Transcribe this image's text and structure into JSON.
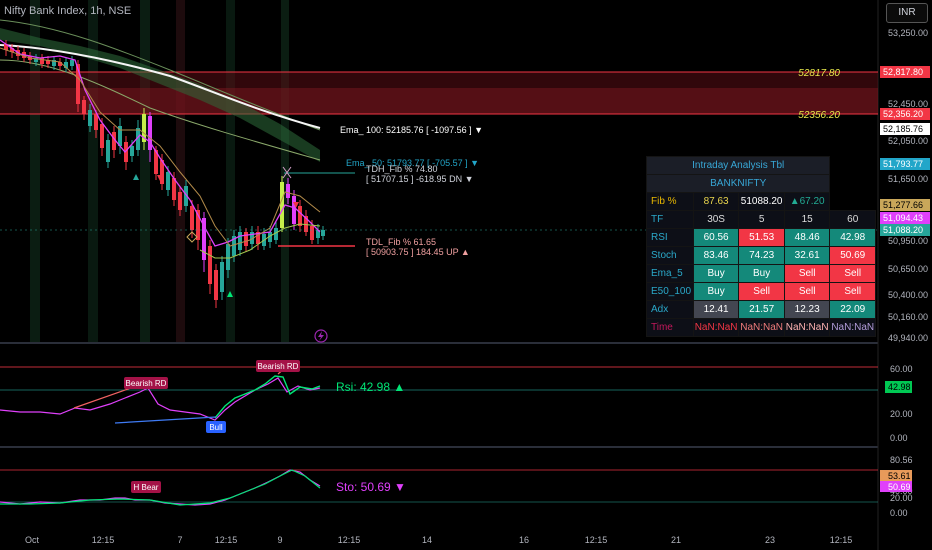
{
  "header": {
    "title": "Nifty Bank Index, 1h, NSE",
    "currency_button": "INR"
  },
  "price_axis": [
    "53,250.00",
    "52,450.00",
    "52,050.00",
    "51,650.00",
    "50,950.00",
    "50,650.00",
    "50,400.00",
    "50,160.00",
    "49,940.00"
  ],
  "price_tags": [
    {
      "text": "52,817.80",
      "bg": "#f23645",
      "fg": "#ffffff"
    },
    {
      "text": "52,356.20",
      "bg": "#f23645",
      "fg": "#ffffff"
    },
    {
      "text": "52,185.76",
      "bg": "#ffffff",
      "fg": "#000000"
    },
    {
      "text": "51,793.77",
      "bg": "#22a6c9",
      "fg": "#ffffff"
    },
    {
      "text": "51,277.66",
      "bg": "#c9a75a",
      "fg": "#000000"
    },
    {
      "text": "51,094.43",
      "bg": "#e040fb",
      "fg": "#ffffff"
    },
    {
      "text": "51,088.20",
      "bg": "#26a69a",
      "fg": "#ffffff"
    }
  ],
  "fib_lines": [
    {
      "label": "52817.80",
      "color": "#e8e84a"
    },
    {
      "label": "52356.20",
      "color": "#e8e84a"
    }
  ],
  "chart_labels": {
    "ema100": "Ema_ 100: 52185.76 [ -1097.56 ] ▼",
    "ema50": "Ema_ 50: 51793.77 [ -705.57 ] ▼",
    "tdh": "TDH_Fib % 74.80",
    "tdh2": "[ 51707.15 ] -618.95 DN ▼",
    "tdl": "TDL_Fib % 61.65",
    "tdl2": "[ 50903.75 ] 184.45 UP ▲"
  },
  "table": {
    "title": "Intraday Analysis Tbl",
    "symbol": "BANKNIFTY",
    "fib": {
      "label": "Fib %",
      "value": "87.63",
      "price": "51088.20",
      "change": "▲67.20"
    },
    "tf": {
      "label": "TF",
      "cols": [
        "30S",
        "5",
        "15",
        "60"
      ]
    },
    "rows": [
      {
        "label": "RSI",
        "values": [
          "60.56",
          "51.53",
          "48.46",
          "42.98"
        ],
        "colors": [
          "g",
          "r",
          "g",
          "g"
        ]
      },
      {
        "label": "Stoch",
        "values": [
          "83.46",
          "74.23",
          "32.61",
          "50.69"
        ],
        "colors": [
          "g",
          "g",
          "g",
          "r"
        ]
      },
      {
        "label": "Ema_5",
        "values": [
          "Buy",
          "Buy",
          "Sell",
          "Sell"
        ],
        "colors": [
          "g",
          "g",
          "r",
          "r"
        ]
      },
      {
        "label": "E50_100",
        "values": [
          "Buy",
          "Sell",
          "Sell",
          "Sell"
        ],
        "colors": [
          "g",
          "r",
          "r",
          "r"
        ]
      },
      {
        "label": "Adx",
        "values": [
          "12.41",
          "21.57",
          "12.23",
          "22.09"
        ],
        "colors": [
          "gy",
          "g",
          "gy",
          "g"
        ]
      }
    ],
    "time": {
      "label": "Time",
      "values": [
        "NaN:NaN",
        "NaN:NaN",
        "NaN:NaN",
        "NaN:NaN"
      ]
    }
  },
  "rsi_panel": {
    "readout": "Rsi: 42.98 ▲",
    "axis": [
      "60.00",
      "40.00",
      "20.00",
      "0.00"
    ],
    "tag": "42.98",
    "labels": [
      "Bearish RD",
      "Bearish RD",
      "Bull"
    ]
  },
  "sto_panel": {
    "readout": "Sto: 50.69 ▼",
    "axis": [
      "80.56",
      "40.00",
      "20.00",
      "0.00"
    ],
    "tags": [
      "53.61",
      "50.69"
    ],
    "label": "H Bear"
  },
  "time_axis": [
    "Oct",
    "12:15",
    "7",
    "12:15",
    "9",
    "12:15",
    "14",
    "16",
    "12:15",
    "21",
    "23",
    "12:15"
  ],
  "colors": {
    "up": "#26a69a",
    "down": "#f23645",
    "bg": "#000000",
    "pink": "#e040fb",
    "lime": "#b8e62e",
    "ema50": "#22a6c9"
  }
}
